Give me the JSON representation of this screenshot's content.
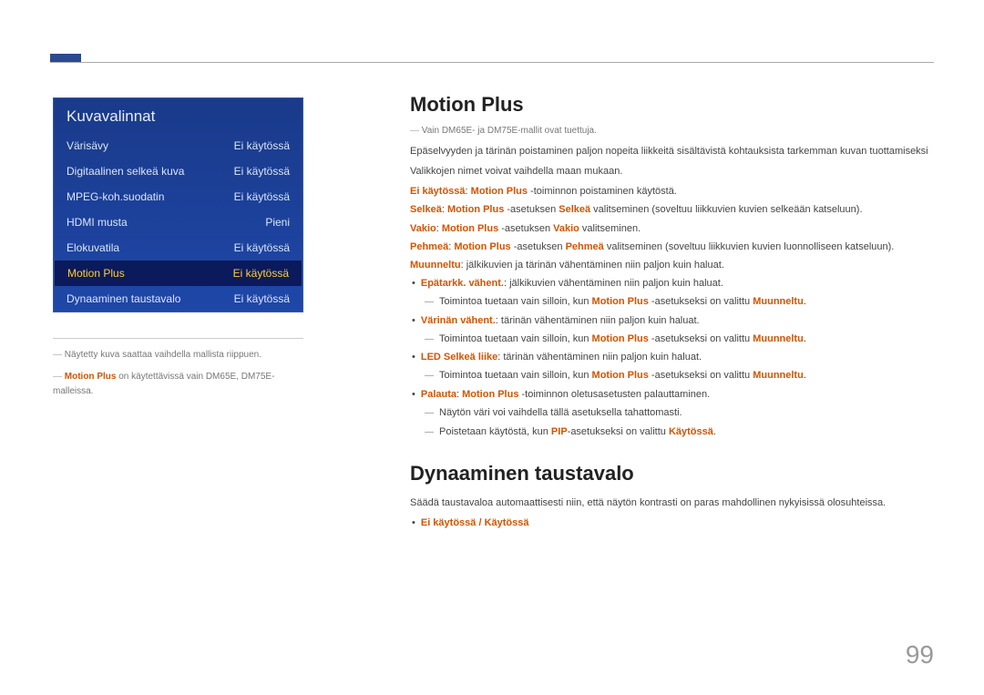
{
  "menu": {
    "title": "Kuvavalinnat",
    "items": [
      {
        "label": "Värisävy",
        "value": "Ei käytössä"
      },
      {
        "label": "Digitaalinen selkeä kuva",
        "value": "Ei käytössä"
      },
      {
        "label": "MPEG-koh.suodatin",
        "value": "Ei käytössä"
      },
      {
        "label": "HDMI musta",
        "value": "Pieni"
      },
      {
        "label": "Elokuvatila",
        "value": "Ei käytössä"
      },
      {
        "label": "Motion Plus",
        "value": "Ei käytössä"
      },
      {
        "label": "Dynaaminen taustavalo",
        "value": "Ei käytössä"
      }
    ]
  },
  "footnotes": {
    "f1": "Näytetty kuva saattaa vaihdella mallista riippuen.",
    "f2_a": "Motion Plus",
    "f2_b": " on käytettävissä vain DM65E, DM75E-malleissa.",
    "f3": "Vain DM65E- ja DM75E-mallit ovat tuettuja."
  },
  "section1": {
    "heading": "Motion Plus",
    "p1": "Epäselvyyden ja tärinän poistaminen paljon nopeita liikkeitä sisältävistä kohtauksista tarkemman kuvan tuottamiseksi",
    "p2": "Valikkojen nimet voivat vaihdella maan mukaan.",
    "opt_off_a": "Ei käytössä",
    "opt_off_b": ": ",
    "opt_off_c": "Motion Plus",
    "opt_off_d": " -toiminnon poistaminen käytöstä.",
    "opt_selkea_a": "Selkeä",
    "opt_selkea_b": ": ",
    "opt_selkea_c": "Motion Plus",
    "opt_selkea_d": " -asetuksen ",
    "opt_selkea_e": "Selkeä",
    "opt_selkea_f": " valitseminen (soveltuu liikkuvien kuvien selkeään katseluun).",
    "opt_vakio_a": "Vakio",
    "opt_vakio_b": ": ",
    "opt_vakio_c": "Motion Plus",
    "opt_vakio_d": " -asetuksen ",
    "opt_vakio_e": "Vakio",
    "opt_vakio_f": " valitseminen.",
    "opt_pehmea_a": "Pehmeä",
    "opt_pehmea_b": ": ",
    "opt_pehmea_c": "Motion Plus",
    "opt_pehmea_d": " -asetuksen ",
    "opt_pehmea_e": "Pehmeä",
    "opt_pehmea_f": " valitseminen (soveltuu liikkuvien kuvien luonnolliseen katseluun).",
    "opt_muun_a": "Muunneltu",
    "opt_muun_b": ": jälkikuvien ja tärinän vähentäminen niin paljon kuin haluat.",
    "b1_a": "Epätarkk. vähent.",
    "b1_b": ": jälkikuvien vähentäminen niin paljon kuin haluat.",
    "b1_sub_a": "Toimintoa tuetaan vain silloin, kun ",
    "b1_sub_b": "Motion Plus",
    "b1_sub_c": " -asetukseksi on valittu ",
    "b1_sub_d": "Muunneltu",
    "b1_sub_e": ".",
    "b2_a": "Värinän vähent.",
    "b2_b": ": tärinän vähentäminen niin paljon kuin haluat.",
    "b3_a": "LED Selkeä liike",
    "b3_b": ": tärinän vähentäminen niin paljon kuin haluat.",
    "b4_a": "Palauta",
    "b4_b": ": ",
    "b4_c": "Motion Plus",
    "b4_d": " -toiminnon oletusasetusten palauttaminen.",
    "b4_sub1": "Näytön väri voi vaihdella tällä asetuksella tahattomasti.",
    "b4_sub2_a": "Poistetaan käytöstä, kun ",
    "b4_sub2_b": "PIP",
    "b4_sub2_c": "-asetukseksi on valittu ",
    "b4_sub2_d": "Käytössä",
    "b4_sub2_e": "."
  },
  "section2": {
    "heading": "Dynaaminen taustavalo",
    "p1": "Säädä taustavaloa automaattisesti niin, että näytön kontrasti on paras mahdollinen nykyisissä olosuhteissa.",
    "b1": "Ei käytössä / Käytössä"
  },
  "page_number": "99"
}
